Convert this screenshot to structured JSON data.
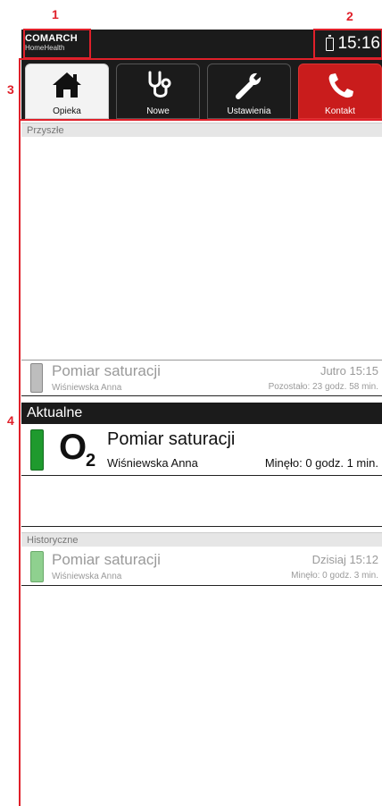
{
  "annotations": {
    "n1": "1",
    "n2": "2",
    "n3": "3",
    "n4": "4"
  },
  "statusbar": {
    "brand_line1": "COMARCH",
    "brand_line2": "HomeHealth",
    "time": "15:16"
  },
  "tabs": [
    {
      "label": "Opieka",
      "icon": "house-icon"
    },
    {
      "label": "Nowe",
      "icon": "stethoscope-icon"
    },
    {
      "label": "Ustawienia",
      "icon": "wrench-icon"
    },
    {
      "label": "Kontakt",
      "icon": "phone-icon"
    }
  ],
  "sections": {
    "future": {
      "heading": "Przyszłe",
      "item": {
        "title": "Pomiar saturacji",
        "patient": "Wiśniewska Anna",
        "when": "Jutro 15:15",
        "remaining": "Pozostało: 23 godz. 58 min."
      }
    },
    "current": {
      "heading": "Aktualne",
      "item": {
        "icon_text": "O",
        "icon_sub": "2",
        "title": "Pomiar saturacji",
        "patient": "Wiśniewska Anna",
        "elapsed": "Minęło: 0 godz. 1 min."
      }
    },
    "history": {
      "heading": "Historyczne",
      "item": {
        "title": "Pomiar saturacji",
        "patient": "Wiśniewska Anna",
        "when": "Dzisiaj 15:12",
        "elapsed": "Minęło: 0 godz. 3 min."
      }
    }
  },
  "colors": {
    "accent_red": "#c91c1c",
    "status_green": "#1f9a2e",
    "future_gray": "#bdbdbd",
    "history_green": "#8fd08f"
  }
}
